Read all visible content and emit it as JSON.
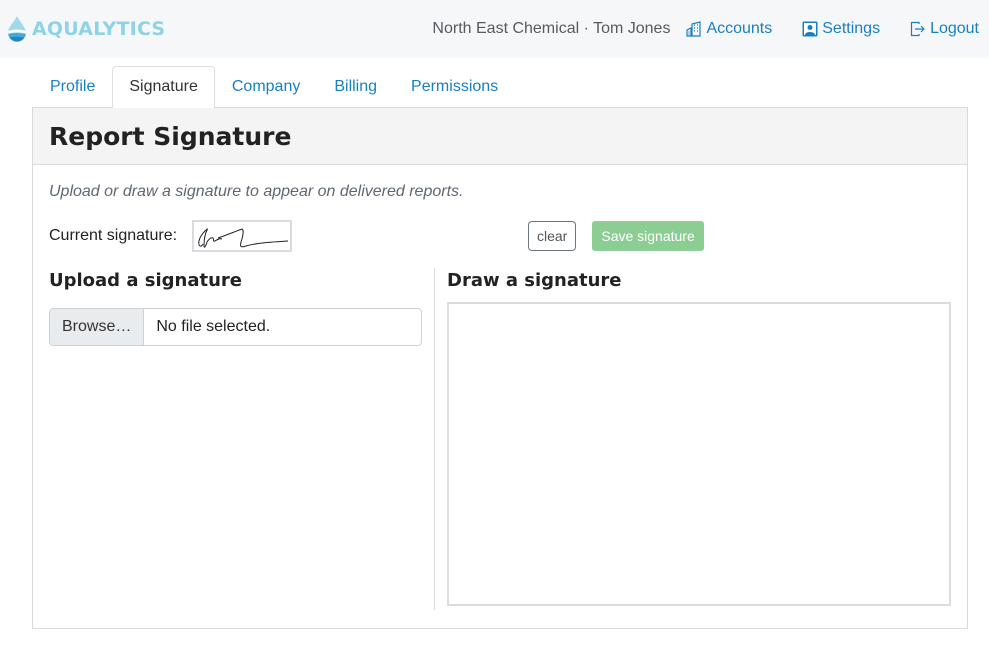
{
  "header": {
    "brand": "AQUALYTICS",
    "user_info": "North East Chemical · Tom Jones",
    "links": [
      {
        "label": "Accounts",
        "icon": "building-icon"
      },
      {
        "label": "Settings",
        "icon": "user-portrait-icon"
      },
      {
        "label": "Logout",
        "icon": "logout-icon"
      }
    ]
  },
  "tabs": [
    {
      "label": "Profile",
      "active": false
    },
    {
      "label": "Signature",
      "active": true
    },
    {
      "label": "Company",
      "active": false
    },
    {
      "label": "Billing",
      "active": false
    },
    {
      "label": "Permissions",
      "active": false
    }
  ],
  "card": {
    "title": "Report Signature",
    "help_text": "Upload or draw a signature to appear on delivered reports.",
    "current_signature_label": "Current signature:",
    "clear_label": "clear",
    "save_label": "Save signature",
    "upload": {
      "title": "Upload a signature",
      "browse_label": "Browse…",
      "file_status": "No file selected."
    },
    "draw": {
      "title": "Draw a signature"
    }
  },
  "colors": {
    "brand": "#8fd3e6",
    "link": "#1a7fc1",
    "save_button": "#8ccd93"
  }
}
